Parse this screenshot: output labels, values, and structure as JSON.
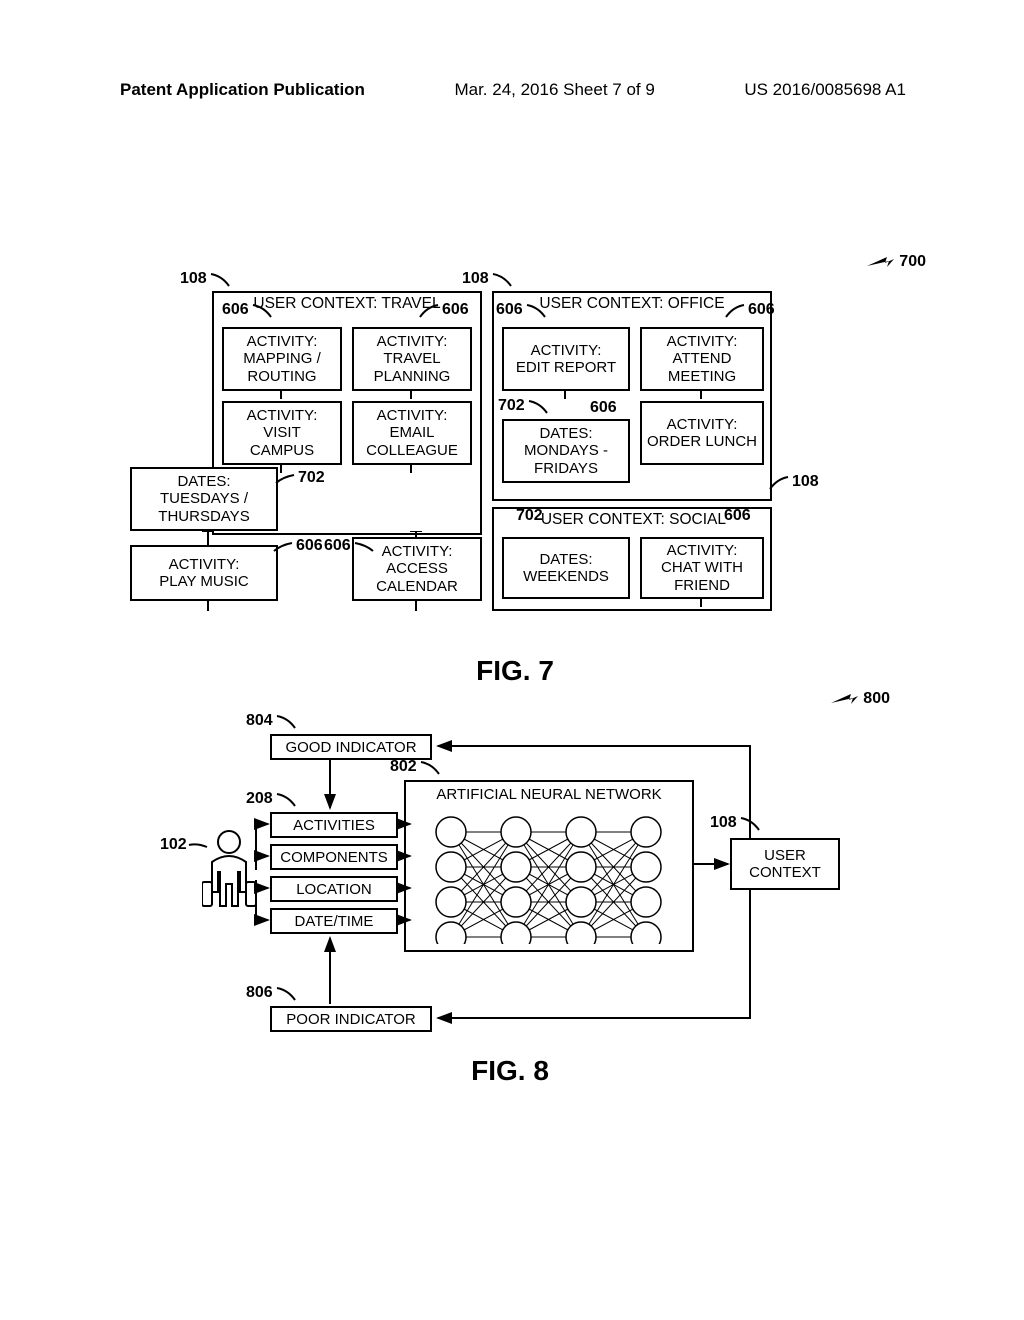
{
  "header": {
    "publication": "Patent Application Publication",
    "date": "Mar. 24, 2016  Sheet 7 of 9",
    "pubno": "US 2016/0085698 A1"
  },
  "fig7": {
    "title": "FIG. 7",
    "callout": "700",
    "contexts": {
      "travel": {
        "ref": "108",
        "title": "USER CONTEXT: TRAVEL",
        "subref": "606",
        "acts": [
          {
            "l1": "ACTIVITY:",
            "l2": "MAPPING /",
            "l3": "ROUTING"
          },
          {
            "l1": "ACTIVITY:",
            "l2": "TRAVEL",
            "l3": "PLANNING"
          },
          {
            "l1": "ACTIVITY:",
            "l2": "VISIT",
            "l3": "CAMPUS"
          },
          {
            "l1": "ACTIVITY:",
            "l2": "EMAIL",
            "l3": "COLLEAGUE"
          }
        ],
        "dates": {
          "ref": "702",
          "l1": "DATES:",
          "l2": "TUESDAYS /",
          "l3": "THURSDAYS"
        }
      },
      "office": {
        "ref": "108",
        "title": "USER CONTEXT: OFFICE",
        "subref": "606",
        "acts": [
          {
            "l1": "ACTIVITY:",
            "l2": "EDIT REPORT",
            "l3": ""
          },
          {
            "l1": "ACTIVITY:",
            "l2": "ATTEND",
            "l3": "MEETING"
          },
          {
            "l1": "ACTIVITY:",
            "l2": "ORDER LUNCH",
            "l3": ""
          }
        ],
        "dates": {
          "ref": "702",
          "l1": "DATES:",
          "l2": "MONDAYS -",
          "l3": "FRIDAYS"
        }
      },
      "social": {
        "ref": "108",
        "title": "USER CONTEXT: SOCIAL",
        "subref": "606",
        "dates": {
          "ref": "702",
          "l1": "DATES:",
          "l2": "WEEKENDS",
          "l3": ""
        },
        "act": {
          "l1": "ACTIVITY:",
          "l2": "CHAT WITH",
          "l3": "FRIEND"
        }
      }
    },
    "shared": {
      "ref606a": "606",
      "ref606b": "606",
      "play": {
        "l1": "ACTIVITY:",
        "l2": "PLAY MUSIC"
      },
      "cal": {
        "l1": "ACTIVITY:",
        "l2": "ACCESS",
        "l3": "CALENDAR"
      }
    }
  },
  "fig8": {
    "title": "FIG. 8",
    "callout": "800",
    "good": {
      "ref": "804",
      "label": "GOOD INDICATOR"
    },
    "poor": {
      "ref": "806",
      "label": "POOR INDICATOR"
    },
    "ann": {
      "ref": "802",
      "label": "ARTIFICIAL NEURAL NETWORK"
    },
    "inputs": {
      "ref208": "208",
      "ref102": "102",
      "items": [
        "ACTIVITIES",
        "COMPONENTS",
        "LOCATION",
        "DATE/TIME"
      ]
    },
    "output": {
      "ref": "108",
      "l1": "USER",
      "l2": "CONTEXT"
    }
  }
}
